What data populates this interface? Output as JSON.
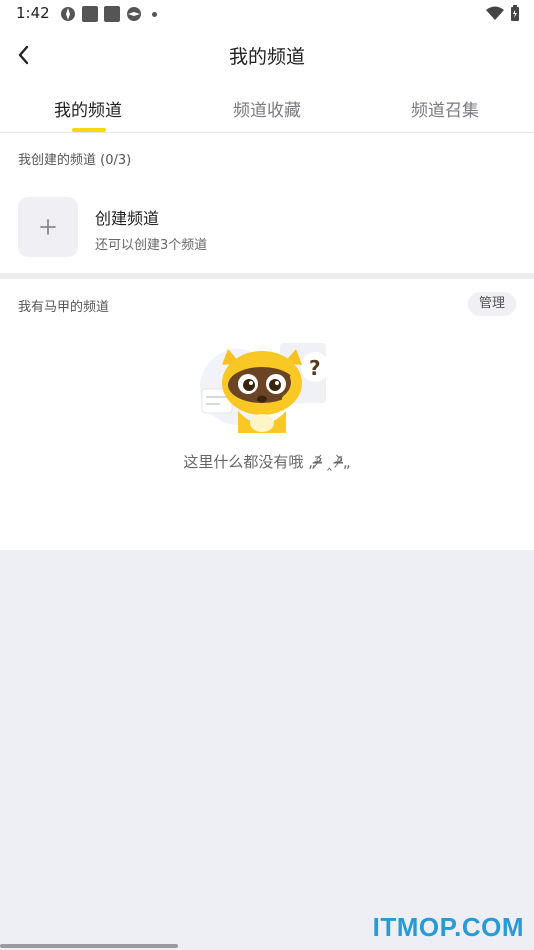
{
  "status_bar": {
    "time": "1:42"
  },
  "header": {
    "title": "我的频道"
  },
  "tabs": [
    {
      "label": "我的频道",
      "active": true
    },
    {
      "label": "频道收藏",
      "active": false
    },
    {
      "label": "频道召集",
      "active": false
    }
  ],
  "created_section": {
    "label": "我创建的频道 (0/3)",
    "create_title": "创建频道",
    "create_subtitle": "还可以创建3个频道"
  },
  "alt_section": {
    "label": "我有马甲的频道",
    "manage_label": "管理",
    "empty_text": "这里什么都没有哦 „ᵒ̴̶̷᷄ ‸ ᵒ̴̶̷᷅„"
  },
  "watermark": "ITMOP.COM",
  "colors": {
    "accent": "#f5d90a",
    "watermark": "#2a9ad6",
    "background_gray": "#eeeff4"
  },
  "icons": [
    "android-icon",
    "square-icon",
    "wifi-icon",
    "battery-icon",
    "back-arrow-icon",
    "plus-icon",
    "raccoon-mascot"
  ]
}
